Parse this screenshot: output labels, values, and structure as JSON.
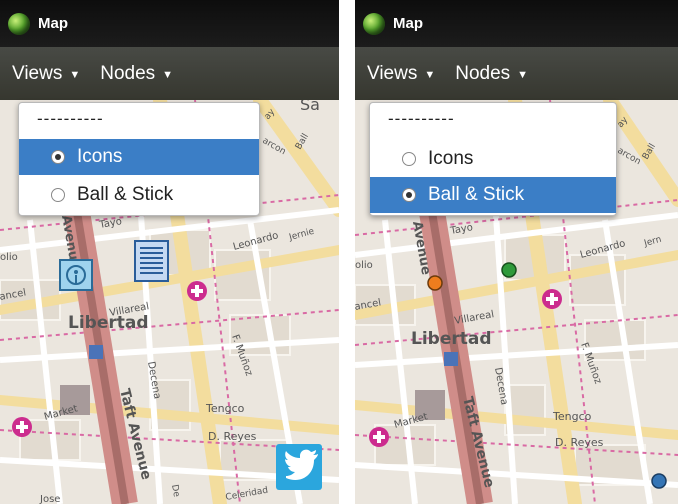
{
  "panels": [
    {
      "window_title": "Map",
      "menu": {
        "views": "Views",
        "nodes": "Nodes"
      },
      "dropdown": {
        "separator": "----------",
        "items": [
          {
            "label": "Icons",
            "selected": true
          },
          {
            "label": "Ball & Stick",
            "selected": false
          }
        ]
      },
      "map_labels": {
        "libertad": "Libertad",
        "taft_avenue": "Taft Avenue",
        "avenue": "Avenue",
        "leonardo": "Leonardo",
        "villareal": "Villareal",
        "market": "Market",
        "tengco": "Tengco",
        "d_reyes": "D. Reyes",
        "decena": "Decena",
        "f_munoz": "F. Muñoz",
        "celeridad": "Celeridad",
        "jose": "Jose",
        "tayo": "Tayo",
        "jernie": "Jernie",
        "ancel": "ancel",
        "olio": "olio",
        "arcon": "arcon",
        "ball": "Ball",
        "sa": "Sa",
        "ay": "ay",
        "de": "De"
      },
      "node_icons": [
        "person-node",
        "document-node",
        "twitter-node"
      ]
    },
    {
      "window_title": "Map",
      "menu": {
        "views": "Views",
        "nodes": "Nodes"
      },
      "dropdown": {
        "separator": "----------",
        "items": [
          {
            "label": "Icons",
            "selected": false
          },
          {
            "label": "Ball & Stick",
            "selected": true
          }
        ]
      },
      "map_labels": {
        "libertad": "Libertad",
        "taft_avenue": "Taft Avenue",
        "avenue": "Avenue",
        "leonardo": "Leonardo",
        "villareal": "Villareal",
        "market": "Market",
        "tengco": "Tengco",
        "d_reyes": "D. Reyes",
        "decena": "Decena",
        "f_munoz": "F. Muñoz",
        "tayo": "Tayo",
        "jernie": "Jern",
        "ancel": "ancel",
        "olio": "olio",
        "arcon": "arcon",
        "ball": "Ball",
        "ay": "ay"
      },
      "node_colors": [
        "#ee7d1e",
        "#2f9a3a",
        "#3575b5"
      ]
    }
  ]
}
